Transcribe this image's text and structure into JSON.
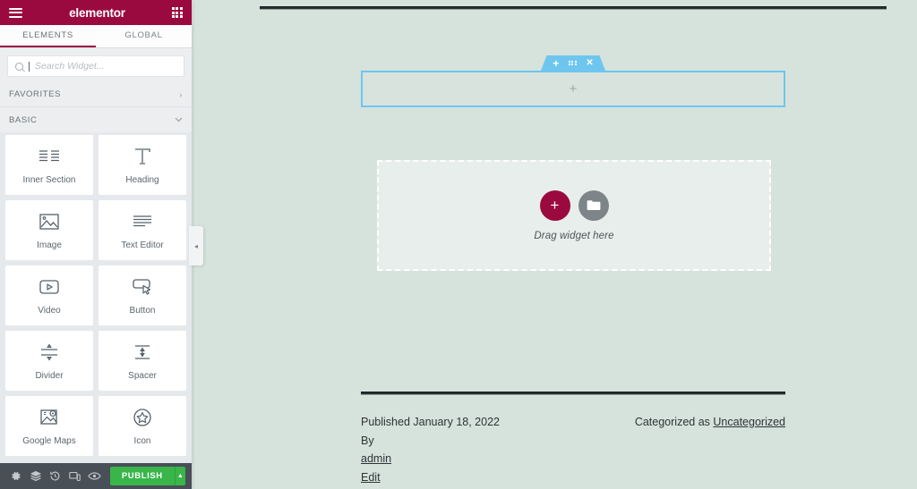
{
  "panel": {
    "header": {
      "brand": "elementor",
      "menu_icon": "hamburger-icon",
      "apps_icon": "apps-grid-icon"
    },
    "tabs": [
      {
        "label": "ELEMENTS",
        "active": true
      },
      {
        "label": "GLOBAL",
        "active": false
      }
    ],
    "search": {
      "placeholder": "Search Widget...",
      "value": "",
      "icon": "search-icon"
    },
    "categories": [
      {
        "label": "FAVORITES",
        "expanded": false,
        "chevron": "›"
      },
      {
        "label": "BASIC",
        "expanded": true,
        "chevron": "∨"
      }
    ],
    "widgets": [
      {
        "label": "Inner Section",
        "icon": "inner-section-icon"
      },
      {
        "label": "Heading",
        "icon": "heading-icon"
      },
      {
        "label": "Image",
        "icon": "image-icon"
      },
      {
        "label": "Text Editor",
        "icon": "text-editor-icon"
      },
      {
        "label": "Video",
        "icon": "video-icon"
      },
      {
        "label": "Button",
        "icon": "button-icon"
      },
      {
        "label": "Divider",
        "icon": "divider-icon"
      },
      {
        "label": "Spacer",
        "icon": "spacer-icon"
      },
      {
        "label": "Google Maps",
        "icon": "google-maps-icon"
      },
      {
        "label": "Icon",
        "icon": "star-icon"
      }
    ],
    "collapse": {
      "icon": "chevron-left-icon",
      "glyph": "◂"
    },
    "footer": {
      "buttons": [
        {
          "name": "settings",
          "icon": "gear-icon"
        },
        {
          "name": "navigator",
          "icon": "layers-icon"
        },
        {
          "name": "history",
          "icon": "history-icon"
        },
        {
          "name": "responsive-mode",
          "icon": "responsive-icon"
        },
        {
          "name": "preview",
          "icon": "eye-icon"
        }
      ],
      "publish_label": "PUBLISH",
      "publish_caret": "▲"
    }
  },
  "canvas": {
    "section": {
      "handle": {
        "add_glyph": "+",
        "drag_icon": "drag-grid-icon",
        "close_glyph": "✕"
      },
      "add_column_glyph": "+"
    },
    "dropzone": {
      "add_glyph": "+",
      "folder_icon": "folder-icon",
      "label": "Drag widget here"
    },
    "post_meta": {
      "published": "Published January 18, 2022",
      "by_prefix": "By ",
      "author": "admin",
      "edit": "Edit",
      "category_prefix": "Categorized as ",
      "category": "Uncategorized"
    }
  },
  "colors": {
    "brand": "#9b0a3e",
    "accent_blue": "#6ec6ef",
    "publish_green": "#39b54a",
    "canvas_bg": "#d6e2dc",
    "panel_bg": "#e6e9ec",
    "footer_bg": "#494f57"
  }
}
